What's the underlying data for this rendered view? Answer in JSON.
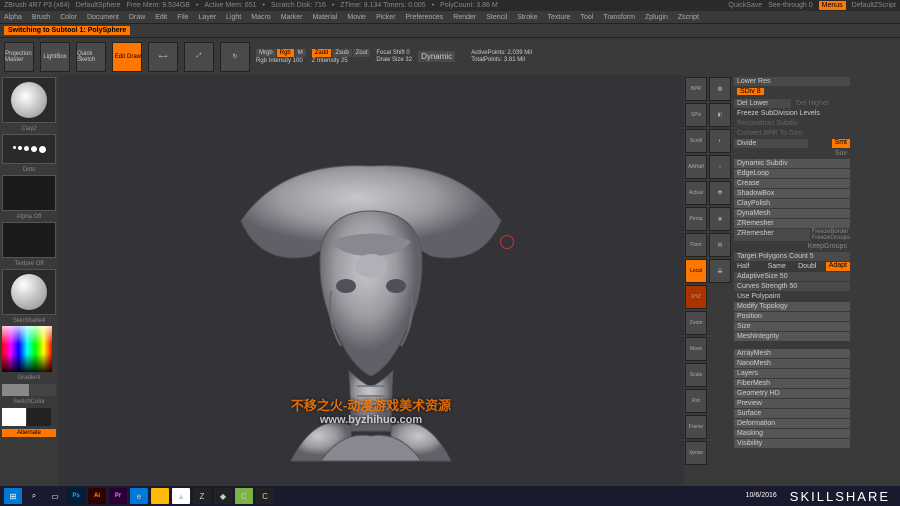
{
  "title": {
    "app": "ZBrush 4R7 P3 (x64)",
    "doc": "DefaultSphere",
    "mem": "Free Mem: 9.534GB",
    "active": "Active Mem: 651",
    "scratch": "Scratch Disk: 716",
    "ztime": "ZTime: 9.134 Timers: 0.005",
    "poly": "PolyCount: 3.86 M",
    "quicksave": "QuickSave",
    "seethrough": "See-through 0",
    "menus": "Menus",
    "script": "DefaultZScript"
  },
  "menu": {
    "items": [
      "Alpha",
      "Brush",
      "Color",
      "Document",
      "Draw",
      "Edit",
      "File",
      "Layer",
      "Light",
      "Macro",
      "Marker",
      "Material",
      "Movie",
      "Picker",
      "Preferences",
      "Render",
      "Stencil",
      "Stroke",
      "Texture",
      "Tool",
      "Transform",
      "Zplugin",
      "Zscript"
    ]
  },
  "subtoolmsg": "Switching to Subtool 1: PolySphere",
  "shelf": {
    "projection": "Projection Master",
    "lightbox": "LightBox",
    "quicksketch": "Quick Sketch",
    "edit": "Edit",
    "draw": "Draw",
    "mrgb": "Mrgb",
    "rgb": "Rgb",
    "m": "M",
    "zadd": "Zadd",
    "zsub": "Zsub",
    "zcut": "Zcut",
    "rgbint": "Rgb Intensity 100",
    "zint": "Z Intensity 25",
    "focal": "Focal Shift 0",
    "drawsize": "Draw Size 32",
    "dynamic": "Dynamic",
    "activepts": "ActivePoints: 2.039 Mil",
    "totalpts": "TotalPoints: 3.81 Mil"
  },
  "left": {
    "brush": "Clay2",
    "stroke": "Dots",
    "alpha": "Alpha Off",
    "texture": "Texture Off",
    "material": "SkinShade4",
    "gradient": "Gradient",
    "switch": "SwitchColor",
    "alternate": "Alternate"
  },
  "ribbon": {
    "items": [
      "BPR",
      "SPix",
      "Scroll",
      "AAHalf",
      "Actual",
      "Persp",
      "Floor",
      "Local",
      "XYZ",
      "Zoom",
      "Move",
      "Scale",
      "Rot",
      "Frame",
      "Xpose"
    ]
  },
  "panel": {
    "lowerres": "Lower Res",
    "sdiv": "SDiv 8",
    "dellower": "Del Lower",
    "delhigher": "Del Higher",
    "freeze": "Freeze SubDivision Levels",
    "reconstruct": "Reconstruct Subdiv",
    "convert": "Convert BPR To Geo",
    "divide": "Divide",
    "smt": "Smt",
    "suv": "Suv",
    "dynsubdiv": "Dynamic Subdiv",
    "edgeloop": "EdgeLoop",
    "crease": "Crease",
    "shadowbox": "ShadowBox",
    "claypolish": "ClayPolish",
    "dynamesh": "DynaMesh",
    "zremesher": "ZRemesher",
    "zremesher2": "ZRemesher",
    "freezeborder": "FreezeBorder",
    "freezegroup": "FreezeGroups",
    "keepgroups": "KeepGroups",
    "target": "Target Polygons Count 5",
    "half": "Half",
    "same": "Same",
    "doubl": "Doubl",
    "adapt": "Adapt",
    "adaptive": "AdaptiveSize 50",
    "curves": "Curves Strength 50",
    "polypaint": "Use Polypaint",
    "modtopo": "Modify Topology",
    "position": "Position",
    "size": "Size",
    "meshint": "MeshIntegrity",
    "arraymesh": "ArrayMesh",
    "nanomesh": "NanoMesh",
    "layers": "Layers",
    "fibermesh": "FiberMesh",
    "geohd": "Geometry HD",
    "preview": "Preview",
    "surface": "Surface",
    "deformation": "Deformation",
    "masking": "Masking",
    "visibility": "Visibility"
  },
  "watermark": {
    "line1": "不移之火-动漫游戏美术资源",
    "line2": "www.byzhihuo.com"
  },
  "taskbar": {
    "date": "10/6/2016"
  },
  "brand": "SKILLSHARE"
}
